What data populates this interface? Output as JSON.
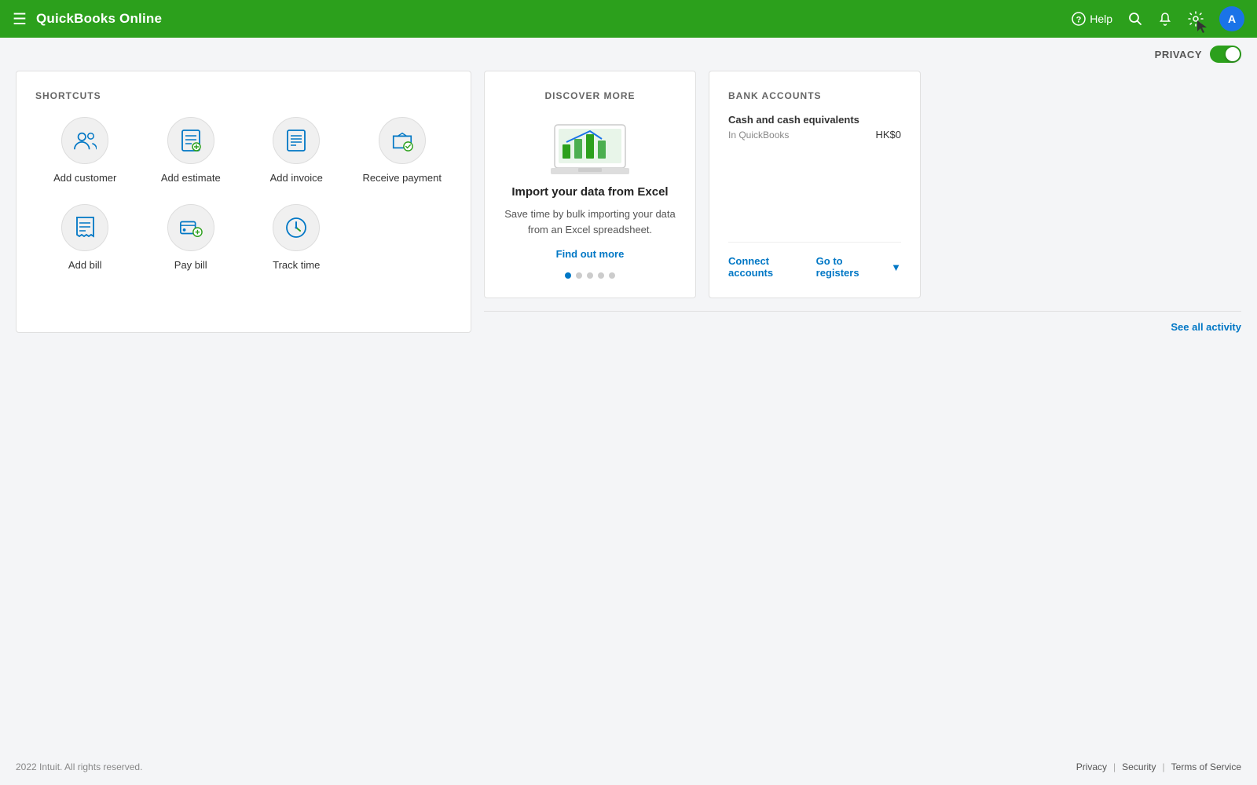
{
  "app": {
    "name": "QuickBooks Online"
  },
  "topnav": {
    "logo": "QuickBooks Online",
    "help": "Help",
    "privacy_label": "PRIVACY"
  },
  "shortcuts": {
    "section_title": "SHORTCUTS",
    "items_row1": [
      {
        "id": "add-customer",
        "label": "Add customer",
        "icon": "people"
      },
      {
        "id": "add-estimate",
        "label": "Add estimate",
        "icon": "estimate"
      },
      {
        "id": "add-invoice",
        "label": "Add invoice",
        "icon": "invoice"
      },
      {
        "id": "receive-payment",
        "label": "Receive payment",
        "icon": "payment"
      }
    ],
    "items_row2": [
      {
        "id": "add-bill",
        "label": "Add bill",
        "icon": "bill"
      },
      {
        "id": "pay-bill",
        "label": "Pay bill",
        "icon": "paybill"
      },
      {
        "id": "track-time",
        "label": "Track time",
        "icon": "time"
      }
    ]
  },
  "discover": {
    "section_title": "DISCOVER MORE",
    "title": "Import your data from Excel",
    "description": "Save time by bulk importing your data from an Excel spreadsheet.",
    "link_text": "Find out more",
    "dots": [
      true,
      false,
      false,
      false,
      false
    ]
  },
  "bank_accounts": {
    "section_title": "BANK ACCOUNTS",
    "category": "Cash and cash equivalents",
    "sub_label": "In QuickBooks",
    "amount": "HK$0",
    "connect_label": "Connect accounts",
    "registers_label": "Go to registers"
  },
  "activity": {
    "see_all": "See all activity"
  },
  "footer": {
    "copyright": "2022 Intuit. All rights reserved.",
    "links": [
      "Privacy",
      "Security",
      "Terms of Service"
    ]
  }
}
